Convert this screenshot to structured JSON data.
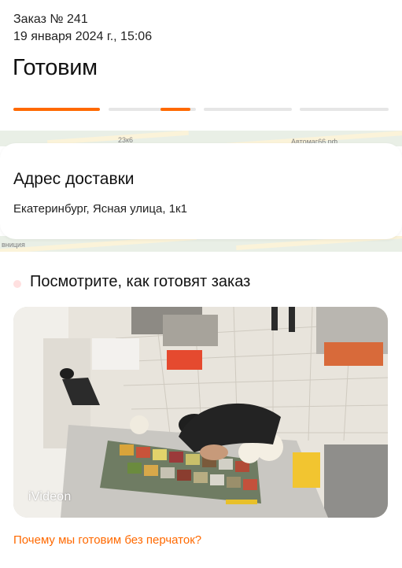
{
  "order": {
    "number": "Заказ № 241",
    "date": "19 января 2024 г., 15:06",
    "status": "Готовим"
  },
  "progress": {
    "segments": 4,
    "completed_segments": 1,
    "current_segment_fill": 0.3,
    "accent_color": "#ff6900"
  },
  "map": {
    "top_labels": [
      "23к6",
      "Автомаг66.рф"
    ],
    "bottom_labels": [
      "вниция"
    ]
  },
  "delivery": {
    "title": "Адрес доставки",
    "address": "Екатеринбург, Ясная улица, 1к1"
  },
  "video": {
    "title": "Посмотрите, как готовят заказ",
    "logo": "iVideon"
  },
  "links": {
    "gloves": "Почему мы готовим без перчаток?"
  }
}
